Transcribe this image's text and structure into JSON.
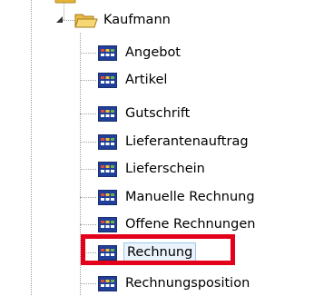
{
  "tree": {
    "parent": {
      "label": "Kaufmann",
      "icon": "folder-open-icon",
      "expanded": true
    },
    "children": [
      {
        "label": "Angebot",
        "icon": "table-icon"
      },
      {
        "label": "Artikel",
        "icon": "table-icon"
      },
      {
        "label": "Gutschrift",
        "icon": "table-icon"
      },
      {
        "label": "Lieferantenauftrag",
        "icon": "table-icon"
      },
      {
        "label": "Lieferschein",
        "icon": "table-icon"
      },
      {
        "label": "Manuelle Rechnung",
        "icon": "table-icon"
      },
      {
        "label": "Offene Rechnungen",
        "icon": "table-icon"
      },
      {
        "label": "Rechnung",
        "icon": "table-icon",
        "selected": true
      },
      {
        "label": "Rechnungsposition",
        "icon": "table-icon"
      }
    ]
  },
  "colors": {
    "highlight": "#e3001b",
    "selection": "#eaf3fb",
    "folder": "#f2c94c"
  }
}
